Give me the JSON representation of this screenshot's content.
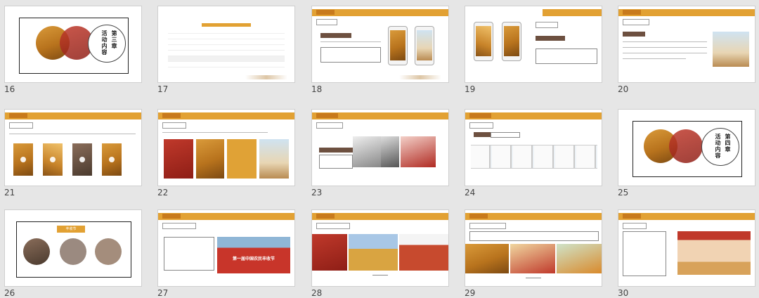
{
  "slides": [
    {
      "number": "16",
      "section": "第三章",
      "title": "活动内容"
    },
    {
      "number": "17"
    },
    {
      "number": "18"
    },
    {
      "number": "19"
    },
    {
      "number": "20"
    },
    {
      "number": "21"
    },
    {
      "number": "22"
    },
    {
      "number": "23"
    },
    {
      "number": "24"
    },
    {
      "number": "25",
      "section": "第四章",
      "title": "活动内容"
    },
    {
      "number": "26",
      "label": "丰收节"
    },
    {
      "number": "27",
      "banner_text": "第一届中国农民丰收节"
    },
    {
      "number": "28"
    },
    {
      "number": "29"
    },
    {
      "number": "30"
    }
  ]
}
